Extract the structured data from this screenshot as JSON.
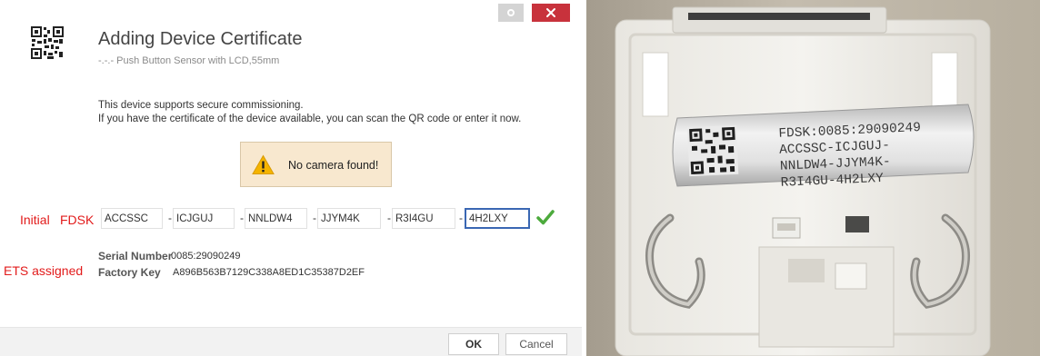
{
  "dialog": {
    "title": "Adding Device Certificate",
    "subtitle": "-.-.- Push Button Sensor with LCD,55mm",
    "info_line_1": "This device supports secure commissioning.",
    "info_line_2": "If you have the certificate of the device available, you can scan the QR code or enter it now.",
    "warning": "No camera found!",
    "fdsk_fields": [
      "ACCSSC",
      "ICJGUJ",
      "NNLDW4",
      "JJYM4K",
      "R3I4GU",
      "4H2LXY"
    ],
    "separator": "-",
    "serial_number_label": "Serial Number",
    "serial_number_value": "0085:29090249",
    "factory_key_label": "Factory Key",
    "factory_key_value": "A896B563B7129C338A8ED1C35387D2EF",
    "ok_label": "OK",
    "cancel_label": "Cancel",
    "icons": [
      "qr-code-icon",
      "warning-icon",
      "check-icon",
      "gear-icon",
      "close-icon"
    ],
    "colors": {
      "close": "#c8323c",
      "warning_bg": "#f8e8cf",
      "check": "#4caa3c",
      "active_border": "#3a67b3"
    }
  },
  "annotations": {
    "initial": "Initial",
    "fdsk": "FDSK",
    "ets_assigned": "ETS assigned",
    "color": "#e21b1b"
  },
  "photo": {
    "label_line_1": "FDSK:0085:29090249",
    "label_line_2": "ACCSSC-ICJGUJ-",
    "label_line_3": "NNLDW4-JJYM4K-",
    "label_line_4": "R3I4GU-4H2LXY"
  }
}
